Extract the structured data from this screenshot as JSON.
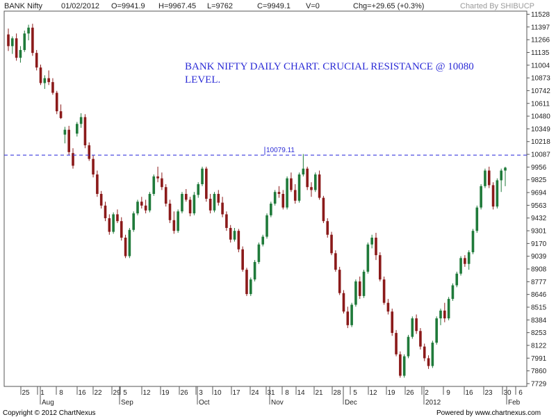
{
  "header": {
    "symbol": "BANK Nifty",
    "date": "01/02/2012",
    "open": "O=9941.9",
    "high": "H=9967.45",
    "low": "L=9762",
    "close": "C=9949.1",
    "volume": "V=0",
    "change": "Chg=+29.65 (+0.3%)",
    "charted_by": "Charted By SHIBUCP"
  },
  "annotation": {
    "line1": "BANK NIFTY DAILY CHART. CRUCIAL RESISTANCE @ 10080",
    "line2": "LEVEL."
  },
  "footer": {
    "copyright": "Copyright © 2012 ChartNexus",
    "powered": "Powered by www.chartnexus.com"
  },
  "colors": {
    "up": "#1f7a3a",
    "down": "#8b1a1a",
    "resistance": "#3b3bdd",
    "frame": "#555555"
  },
  "chart_data": {
    "type": "candlestick",
    "ylim": [
      7700,
      11560
    ],
    "yticks": [
      11528,
      11397,
      11266,
      11135,
      11004,
      10873,
      10742,
      10611,
      10480,
      10349,
      10218,
      10087,
      9956,
      9825,
      9694,
      9563,
      9432,
      9301,
      9170,
      9039,
      8908,
      8777,
      8646,
      8515,
      8384,
      8253,
      8122,
      7991,
      7860,
      7729
    ],
    "xticks": [
      "25",
      "1",
      "8",
      "16",
      "22",
      "29",
      "5",
      "12",
      "19",
      "26",
      "3",
      "10",
      "17",
      "24",
      "31",
      "8",
      "14",
      "21",
      "28",
      "5",
      "12",
      "19",
      "26",
      "2",
      "9",
      "16",
      "23",
      "30",
      "6"
    ],
    "months": [
      "Aug",
      "Sep",
      "Oct",
      "Nov",
      "Dec",
      "2012",
      "Feb"
    ],
    "resistance": {
      "value": 10079.11,
      "label": "10079.11"
    },
    "candles": [
      [
        11320,
        11380,
        11150,
        11200
      ],
      [
        11200,
        11300,
        11120,
        11280
      ],
      [
        11280,
        11330,
        11050,
        11080
      ],
      [
        11080,
        11200,
        11030,
        11160
      ],
      [
        11160,
        11360,
        11140,
        11330
      ],
      [
        11330,
        11420,
        11260,
        11390
      ],
      [
        11390,
        11430,
        11100,
        11130
      ],
      [
        11130,
        11160,
        10950,
        10980
      ],
      [
        10980,
        11010,
        10800,
        10820
      ],
      [
        10820,
        10900,
        10760,
        10870
      ],
      [
        10870,
        10950,
        10800,
        10830
      ],
      [
        10830,
        10870,
        10700,
        10720
      ],
      [
        10720,
        10740,
        10500,
        10530
      ],
      [
        10530,
        10600,
        10450,
        10460
      ],
      [
        10290,
        10370,
        10200,
        10340
      ],
      [
        10340,
        10380,
        10080,
        10110
      ],
      [
        10100,
        10150,
        9940,
        9970
      ],
      [
        10300,
        10420,
        10270,
        10400
      ],
      [
        10400,
        10510,
        10360,
        10470
      ],
      [
        10470,
        10500,
        10150,
        10180
      ],
      [
        10180,
        10210,
        10020,
        10040
      ],
      [
        10040,
        10080,
        9850,
        9880
      ],
      [
        9880,
        9920,
        9650,
        9680
      ],
      [
        9680,
        9710,
        9530,
        9560
      ],
      [
        9560,
        9600,
        9400,
        9430
      ],
      [
        9430,
        9470,
        9260,
        9290
      ],
      [
        9290,
        9490,
        9270,
        9470
      ],
      [
        9470,
        9520,
        9380,
        9400
      ],
      [
        9400,
        9440,
        9200,
        9230
      ],
      [
        9230,
        9260,
        9020,
        9040
      ],
      [
        9040,
        9330,
        9020,
        9310
      ],
      [
        9310,
        9500,
        9290,
        9480
      ],
      [
        9480,
        9620,
        9460,
        9600
      ],
      [
        9600,
        9650,
        9530,
        9560
      ],
      [
        9560,
        9620,
        9480,
        9510
      ],
      [
        9510,
        9700,
        9490,
        9680
      ],
      [
        9680,
        9880,
        9660,
        9860
      ],
      [
        9860,
        9960,
        9800,
        9840
      ],
      [
        9840,
        9900,
        9720,
        9750
      ],
      [
        9750,
        9780,
        9550,
        9580
      ],
      [
        9580,
        9620,
        9380,
        9410
      ],
      [
        9410,
        9500,
        9270,
        9300
      ],
      [
        9300,
        9520,
        9280,
        9500
      ],
      [
        9500,
        9700,
        9480,
        9680
      ],
      [
        9680,
        9730,
        9600,
        9620
      ],
      [
        9620,
        9650,
        9450,
        9480
      ],
      [
        9480,
        9700,
        9460,
        9670
      ],
      [
        9670,
        9800,
        9640,
        9780
      ],
      [
        9780,
        9960,
        9760,
        9940
      ],
      [
        9940,
        9960,
        9600,
        9630
      ],
      [
        9630,
        9680,
        9480,
        9510
      ],
      [
        9510,
        9700,
        9490,
        9680
      ],
      [
        9680,
        9720,
        9560,
        9590
      ],
      [
        9590,
        9650,
        9440,
        9470
      ],
      [
        9470,
        9500,
        9300,
        9330
      ],
      [
        9330,
        9360,
        9180,
        9210
      ],
      [
        9210,
        9330,
        9190,
        9300
      ],
      [
        9300,
        9320,
        9080,
        9110
      ],
      [
        9110,
        9140,
        8880,
        8900
      ],
      [
        8900,
        8920,
        8630,
        8650
      ],
      [
        8650,
        8820,
        8630,
        8800
      ],
      [
        8800,
        9000,
        8780,
        8980
      ],
      [
        8980,
        9180,
        8960,
        9160
      ],
      [
        9160,
        9260,
        9140,
        9240
      ],
      [
        9240,
        9480,
        9220,
        9460
      ],
      [
        9460,
        9600,
        9440,
        9580
      ],
      [
        9580,
        9720,
        9560,
        9700
      ],
      [
        9700,
        9760,
        9640,
        9680
      ],
      [
        9680,
        9720,
        9520,
        9540
      ],
      [
        9540,
        9860,
        9520,
        9840
      ],
      [
        9840,
        9900,
        9700,
        9720
      ],
      [
        9720,
        9780,
        9580,
        9610
      ],
      [
        9610,
        9900,
        9590,
        9880
      ],
      [
        9880,
        10090,
        9860,
        9940
      ],
      [
        9940,
        9960,
        9720,
        9750
      ],
      [
        9750,
        9800,
        9650,
        9720
      ],
      [
        9720,
        9900,
        9700,
        9880
      ],
      [
        9880,
        9920,
        9620,
        9640
      ],
      [
        9640,
        9660,
        9380,
        9400
      ],
      [
        9400,
        9430,
        9230,
        9260
      ],
      [
        9260,
        9290,
        9050,
        9070
      ],
      [
        9070,
        9100,
        8880,
        8900
      ],
      [
        8900,
        8930,
        8640,
        8660
      ],
      [
        8660,
        8690,
        8450,
        8470
      ],
      [
        8470,
        8520,
        8300,
        8330
      ],
      [
        8330,
        8560,
        8310,
        8540
      ],
      [
        8540,
        8800,
        8520,
        8780
      ],
      [
        8780,
        8830,
        8600,
        8630
      ],
      [
        8630,
        8900,
        8610,
        8880
      ],
      [
        8880,
        9180,
        8860,
        9160
      ],
      [
        9160,
        9260,
        9120,
        9230
      ],
      [
        9230,
        9280,
        9000,
        9050
      ],
      [
        9050,
        9080,
        8780,
        8800
      ],
      [
        8800,
        8830,
        8540,
        8560
      ],
      [
        8560,
        8600,
        8440,
        8470
      ],
      [
        8470,
        8500,
        8220,
        8250
      ],
      [
        8250,
        8280,
        8010,
        8030
      ],
      [
        8030,
        8060,
        7790,
        7810
      ],
      [
        7810,
        8030,
        7790,
        8010
      ],
      [
        8010,
        8230,
        7990,
        8210
      ],
      [
        8210,
        8420,
        8190,
        8400
      ],
      [
        8400,
        8440,
        8240,
        8270
      ],
      [
        8270,
        8300,
        8080,
        8110
      ],
      [
        8110,
        8140,
        7960,
        7990
      ],
      [
        7990,
        8020,
        7880,
        7910
      ],
      [
        7910,
        8170,
        7890,
        8150
      ],
      [
        8150,
        8420,
        8130,
        8400
      ],
      [
        8400,
        8500,
        8330,
        8480
      ],
      [
        8480,
        8560,
        8360,
        8400
      ],
      [
        8400,
        8620,
        8380,
        8600
      ],
      [
        8600,
        8760,
        8580,
        8740
      ],
      [
        8740,
        8880,
        8720,
        8860
      ],
      [
        8860,
        9040,
        8840,
        9020
      ],
      [
        9020,
        9050,
        8930,
        8960
      ],
      [
        8960,
        9100,
        8900,
        9080
      ],
      [
        9080,
        9320,
        9060,
        9300
      ],
      [
        9300,
        9560,
        9280,
        9540
      ],
      [
        9540,
        9780,
        9520,
        9760
      ],
      [
        9760,
        9940,
        9740,
        9920
      ],
      [
        9920,
        9960,
        9740,
        9770
      ],
      [
        9770,
        9800,
        9520,
        9550
      ],
      [
        9550,
        9840,
        9530,
        9820
      ],
      [
        9820,
        9940,
        9700,
        9920
      ],
      [
        9920,
        9960,
        9760,
        9950
      ]
    ]
  }
}
